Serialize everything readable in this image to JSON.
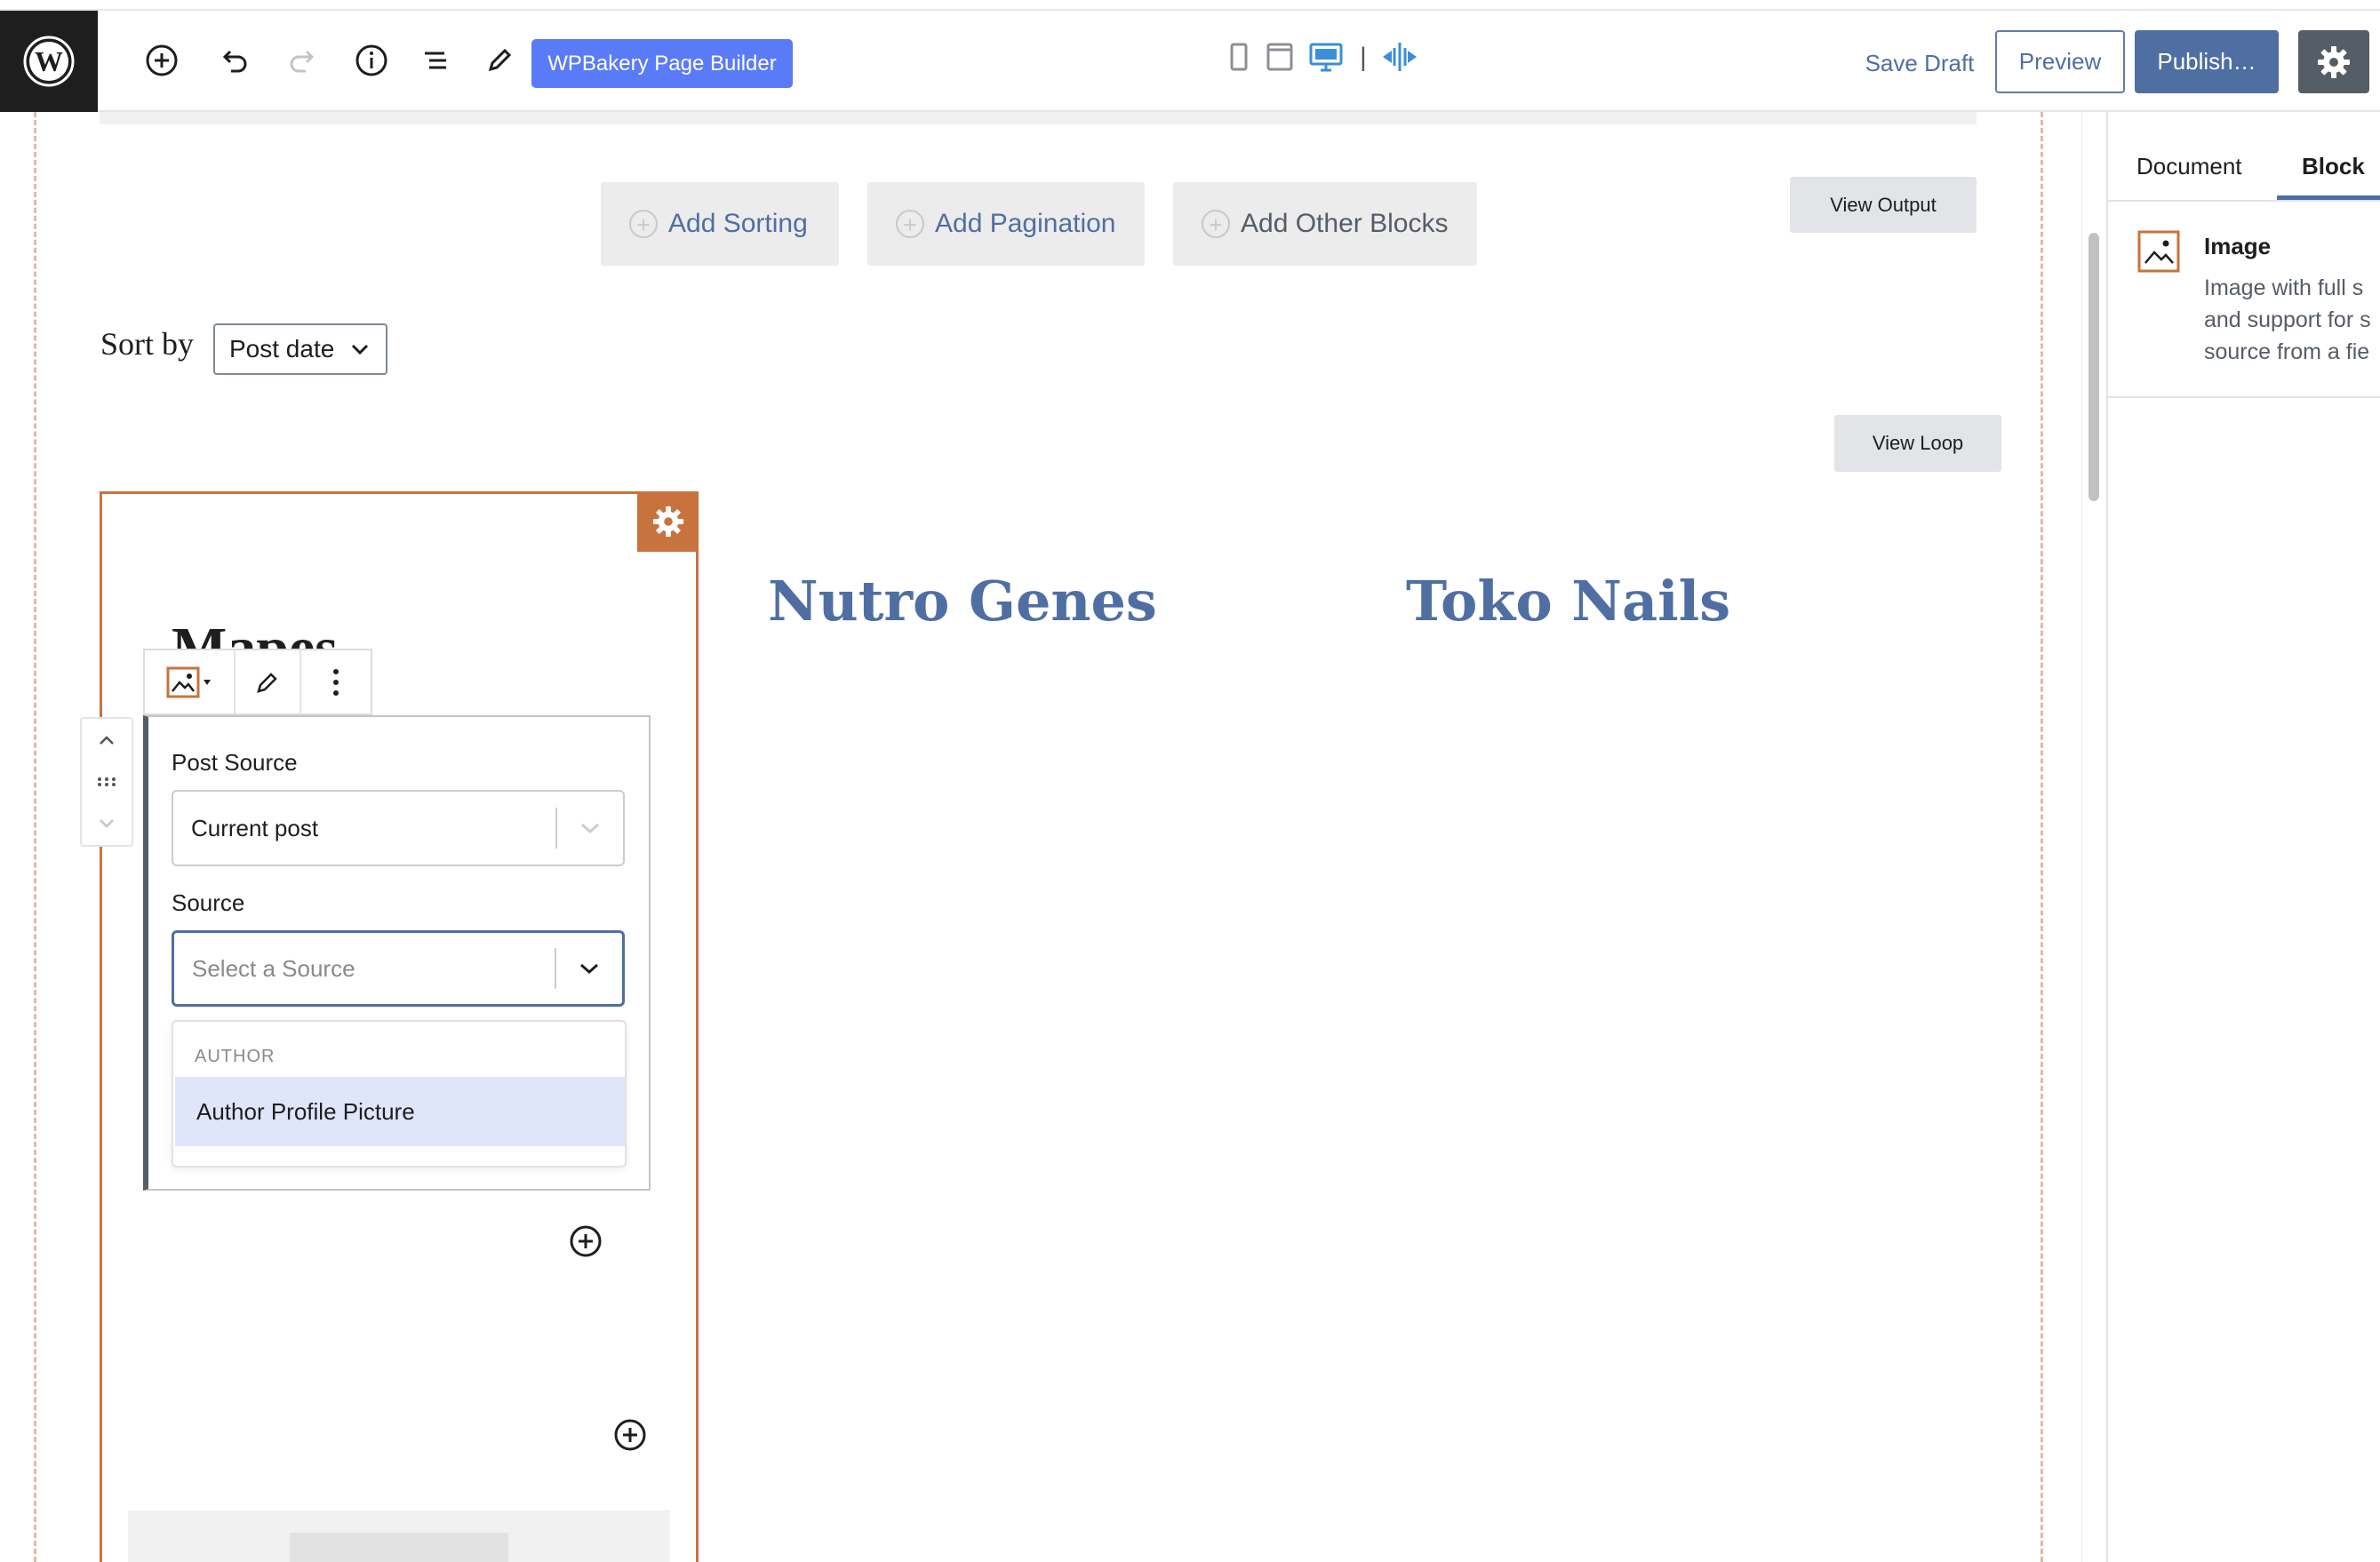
{
  "toolbar": {
    "wpbakery_label": "WPBakery Page Builder",
    "save_draft_label": "Save Draft",
    "preview_label": "Preview",
    "publish_label": "Publish…",
    "separator": "|"
  },
  "canvas": {
    "add_sorting": "Add Sorting",
    "add_pagination": "Add Pagination",
    "add_other_blocks": "Add Other Blocks",
    "view_output": "View Output",
    "view_loop": "View Loop",
    "sort_by_label": "Sort by",
    "sort_by_value": "Post date"
  },
  "posts": {
    "card_title": "Mapes",
    "titles": [
      "Nutro Genes",
      "Toko Nails"
    ]
  },
  "block_panel": {
    "post_source_label": "Post Source",
    "post_source_value": "Current post",
    "source_label": "Source",
    "source_placeholder": "Select a Source",
    "dropdown": {
      "group_heading": "AUTHOR",
      "options": [
        "Author Profile Picture"
      ]
    }
  },
  "sidebar": {
    "tabs": [
      "Document",
      "Block"
    ],
    "active_tab": "Block",
    "block_card": {
      "title": "Image",
      "description_lines": [
        "Image with full s",
        "and support for s",
        "source from a fie"
      ]
    }
  },
  "colors": {
    "accent": "#4f6fa3",
    "wpbakery": "#5a7bf7",
    "card_border": "#c8733d",
    "highlight": "#dfe6fb"
  }
}
